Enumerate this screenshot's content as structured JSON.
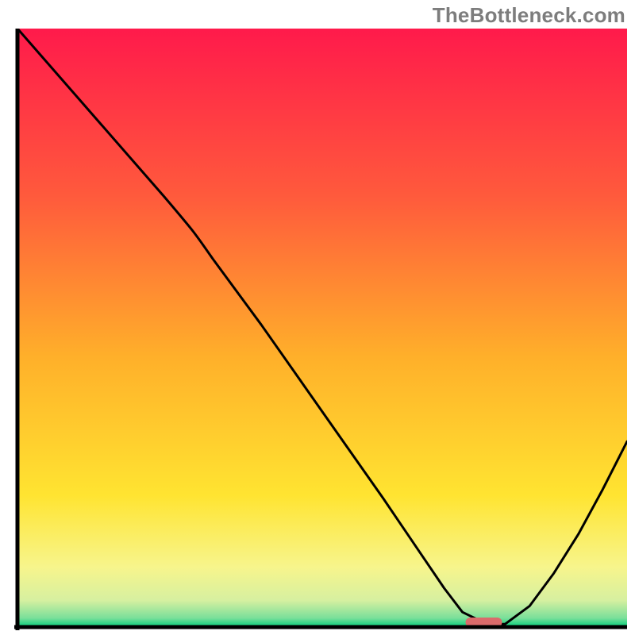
{
  "watermark": "TheBottleneck.com",
  "chart_data": {
    "type": "line",
    "title": "",
    "xlabel": "",
    "ylabel": "",
    "x_range": [
      0,
      100
    ],
    "y_range": [
      0,
      100
    ],
    "grid": false,
    "legend": false,
    "background_gradient": {
      "stops": [
        {
          "pos": 0.0,
          "color": "#ff1a4b"
        },
        {
          "pos": 0.28,
          "color": "#ff5a3c"
        },
        {
          "pos": 0.55,
          "color": "#ffb02a"
        },
        {
          "pos": 0.78,
          "color": "#ffe431"
        },
        {
          "pos": 0.9,
          "color": "#f7f58c"
        },
        {
          "pos": 0.955,
          "color": "#d7f0a0"
        },
        {
          "pos": 0.985,
          "color": "#7adf9a"
        },
        {
          "pos": 1.0,
          "color": "#00cf7a"
        }
      ]
    },
    "series": [
      {
        "name": "bottleneck-curve",
        "color": "#000000",
        "stroke_width": 3,
        "x": [
          0.0,
          12,
          24,
          29,
          40,
          50,
          60,
          66,
          70,
          73,
          77,
          80,
          84,
          88,
          92,
          96,
          100
        ],
        "y": [
          100,
          86,
          72,
          66,
          50.5,
          36,
          21.5,
          12.5,
          6.5,
          2.5,
          0.5,
          0.5,
          3.5,
          9,
          15.5,
          23,
          31
        ]
      }
    ],
    "markers": [
      {
        "name": "optimal-marker",
        "shape": "rounded-rect",
        "color": "#da6b6b",
        "x_range_pct": [
          73.5,
          79.5
        ],
        "y_pct": 0.0,
        "height_pct": 1.6
      }
    ],
    "axes": {
      "left": {
        "color": "#000000",
        "width": 4
      },
      "bottom": {
        "color": "#000000",
        "width": 4
      }
    }
  }
}
